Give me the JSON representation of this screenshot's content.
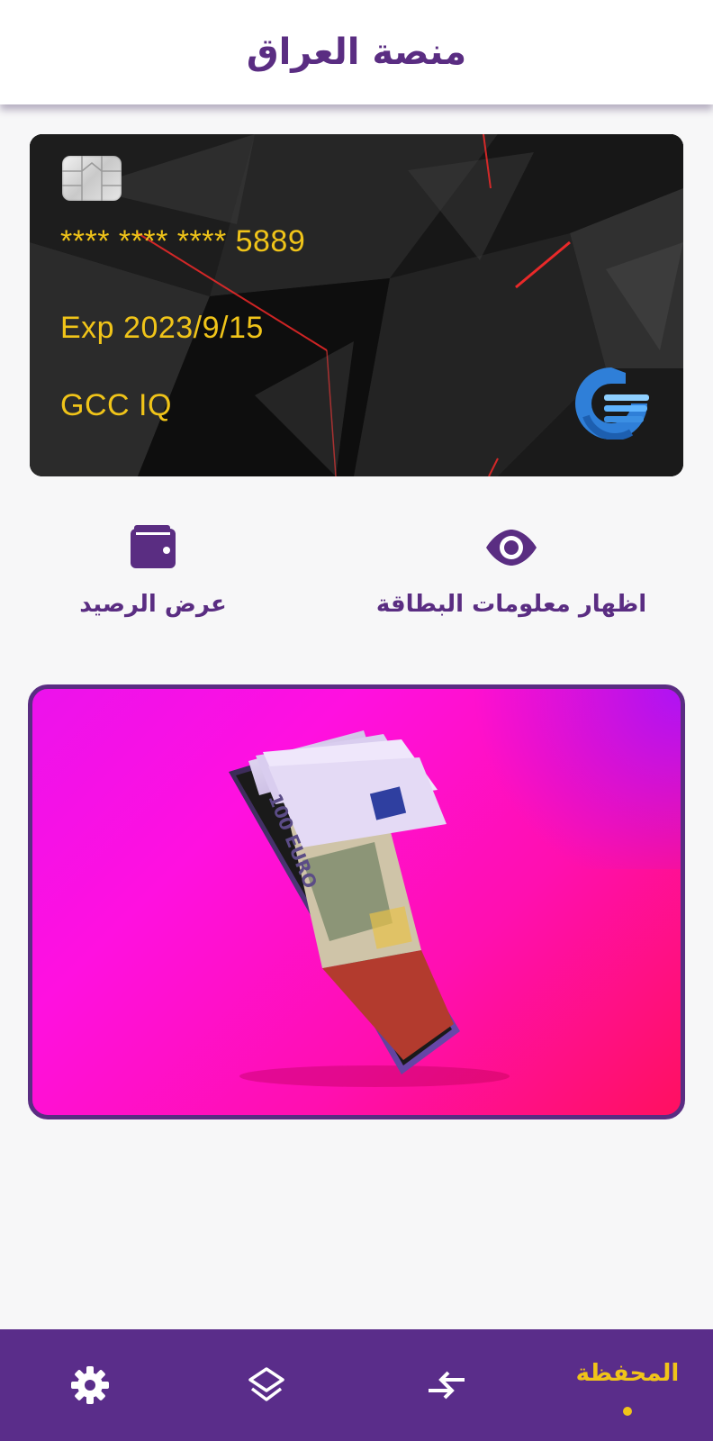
{
  "header": {
    "title": "منصة العراق"
  },
  "card": {
    "number": "**** **** **** 5889",
    "expiry": "Exp 2023/9/15",
    "holder": "GCC IQ",
    "text_color": "#f0c419"
  },
  "actions": {
    "show_card_info": {
      "label": "اظهار معلومات البطاقة",
      "icon": "eye-icon"
    },
    "show_balance": {
      "label": "عرض الرصيد",
      "icon": "wallet-icon"
    }
  },
  "promo": {
    "image": "phone-with-euro-banknotes",
    "banknote_text": "100 EURO"
  },
  "bottom_nav": {
    "items": [
      {
        "label": "المحفظة",
        "icon": "wallet",
        "active": true
      },
      {
        "label": "",
        "icon": "transfer-arrows-icon",
        "active": false
      },
      {
        "label": "",
        "icon": "layers-icon",
        "active": false
      },
      {
        "label": "",
        "icon": "gear-icon",
        "active": false
      }
    ]
  },
  "colors": {
    "primary": "#5a2d82",
    "accent": "#f0c419",
    "nav_background": "#5a2d8a",
    "promo_gradient_start": "#ec12ec",
    "promo_gradient_end": "#ff1060"
  }
}
